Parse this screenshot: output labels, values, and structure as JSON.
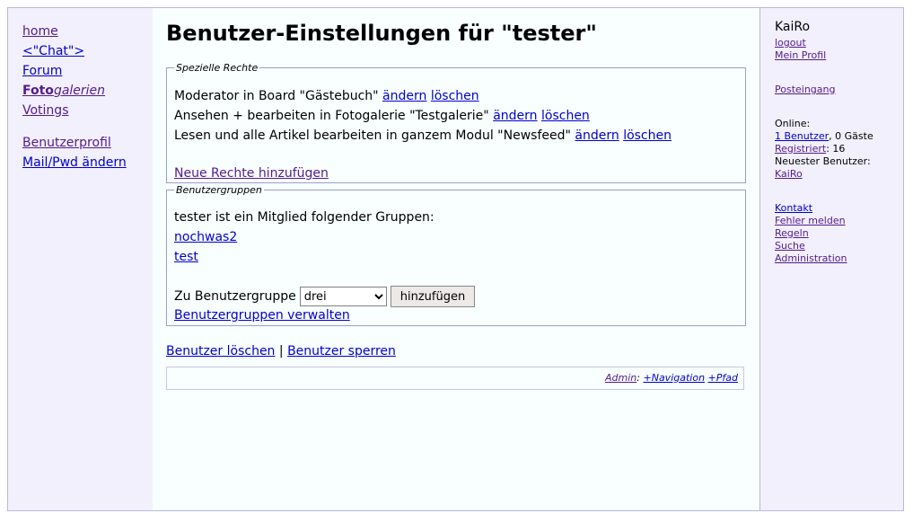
{
  "nav": {
    "home": "home",
    "chat": "<\"Chat\">",
    "forum": "Forum",
    "foto_bold": "Foto",
    "foto_italic": "galerien",
    "votings": "Votings",
    "profile": "Benutzerprofil",
    "mailpwd": "Mail/Pwd ändern"
  },
  "main": {
    "title": "Benutzer-Einstellungen für \"tester\"",
    "rights": {
      "legend": "Spezielle Rechte",
      "items": [
        {
          "text": "Moderator in Board \"Gästebuch\"",
          "edit": "ändern",
          "delete": "löschen"
        },
        {
          "text": "Ansehen + bearbeiten in Fotogalerie \"Testgalerie\"",
          "edit": "ändern",
          "delete": "löschen"
        },
        {
          "text": "Lesen und alle Artikel bearbeiten in ganzem Modul \"Newsfeed\"",
          "edit": "ändern",
          "delete": "löschen"
        }
      ],
      "add_link": "Neue Rechte hinzufügen"
    },
    "groups": {
      "legend": "Benutzergruppen",
      "intro": "tester ist ein Mitglied folgender Gruppen:",
      "items": [
        "nochwas2",
        "test"
      ],
      "add_label": "Zu Benutzergruppe",
      "select_value": "drei",
      "add_button": "hinzufügen",
      "manage_link": "Benutzergruppen verwalten"
    },
    "actions": {
      "delete_user": "Benutzer löschen",
      "separator": "|",
      "block_user": "Benutzer sperren"
    },
    "admin_bar": {
      "admin": "Admin",
      "colon": ":",
      "navigation": "+Navigation",
      "path": "+Pfad"
    }
  },
  "sidebar_right": {
    "username": "KaiRo",
    "logout": "logout",
    "my_profile": "Mein Profil",
    "inbox": "Posteingang",
    "online_label": "Online:",
    "online_users": "1 Benutzer",
    "online_guests": ", 0 Gäste",
    "registered_label": "Registriert",
    "registered_count": ": 16",
    "newest_label": "Neuester Benutzer:",
    "newest_user": "KaiRo",
    "contact": "Kontakt",
    "report_error": "Fehler melden",
    "rules": "Regeln",
    "search": "Suche",
    "administration": "Administration"
  }
}
